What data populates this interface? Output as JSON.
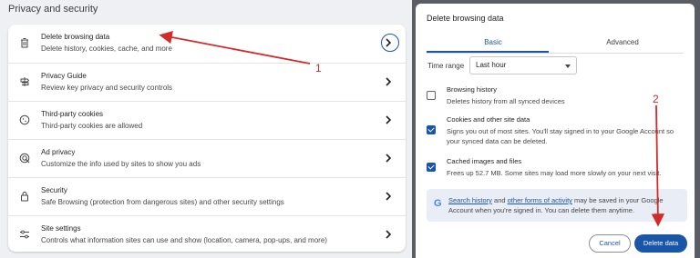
{
  "left": {
    "title": "Privacy and security",
    "rows": [
      {
        "title": "Delete browsing data",
        "desc": "Delete history, cookies, cache, and more"
      },
      {
        "title": "Privacy Guide",
        "desc": "Review key privacy and security controls"
      },
      {
        "title": "Third-party cookies",
        "desc": "Third-party cookies are allowed"
      },
      {
        "title": "Ad privacy",
        "desc": "Customize the info used by sites to show you ads"
      },
      {
        "title": "Security",
        "desc": "Safe Browsing (protection from dangerous sites) and other security settings"
      },
      {
        "title": "Site settings",
        "desc": "Controls what information sites can use and show (location, camera, pop-ups, and more)"
      }
    ]
  },
  "dialog": {
    "title": "Delete browsing data",
    "tabs": [
      "Basic",
      "Advanced"
    ],
    "time_range_label": "Time range",
    "time_range_value": "Last hour",
    "options": [
      {
        "title": "Browsing history",
        "desc": "Deletes history from all synced devices",
        "checked": false
      },
      {
        "title": "Cookies and other site data",
        "desc": "Signs you out of most sites. You'll stay signed in to your Google Account so your synced data can be deleted.",
        "checked": true
      },
      {
        "title": "Cached images and files",
        "desc": "Frees up 52.7 MB. Some sites may load more slowly on your next visit.",
        "checked": true
      }
    ],
    "google_notice": {
      "link1": "Search history",
      "and": "and",
      "link2": "other forms of activity",
      "rest": "may be saved in your Google Account when you're signed in. You can delete them anytime."
    },
    "cancel_label": "Cancel",
    "delete_label": "Delete data"
  },
  "annotations": {
    "step1": "1",
    "step2": "2",
    "accent": "#d42a2a"
  },
  "colors": {
    "brand_blue": "#1a56a8"
  }
}
